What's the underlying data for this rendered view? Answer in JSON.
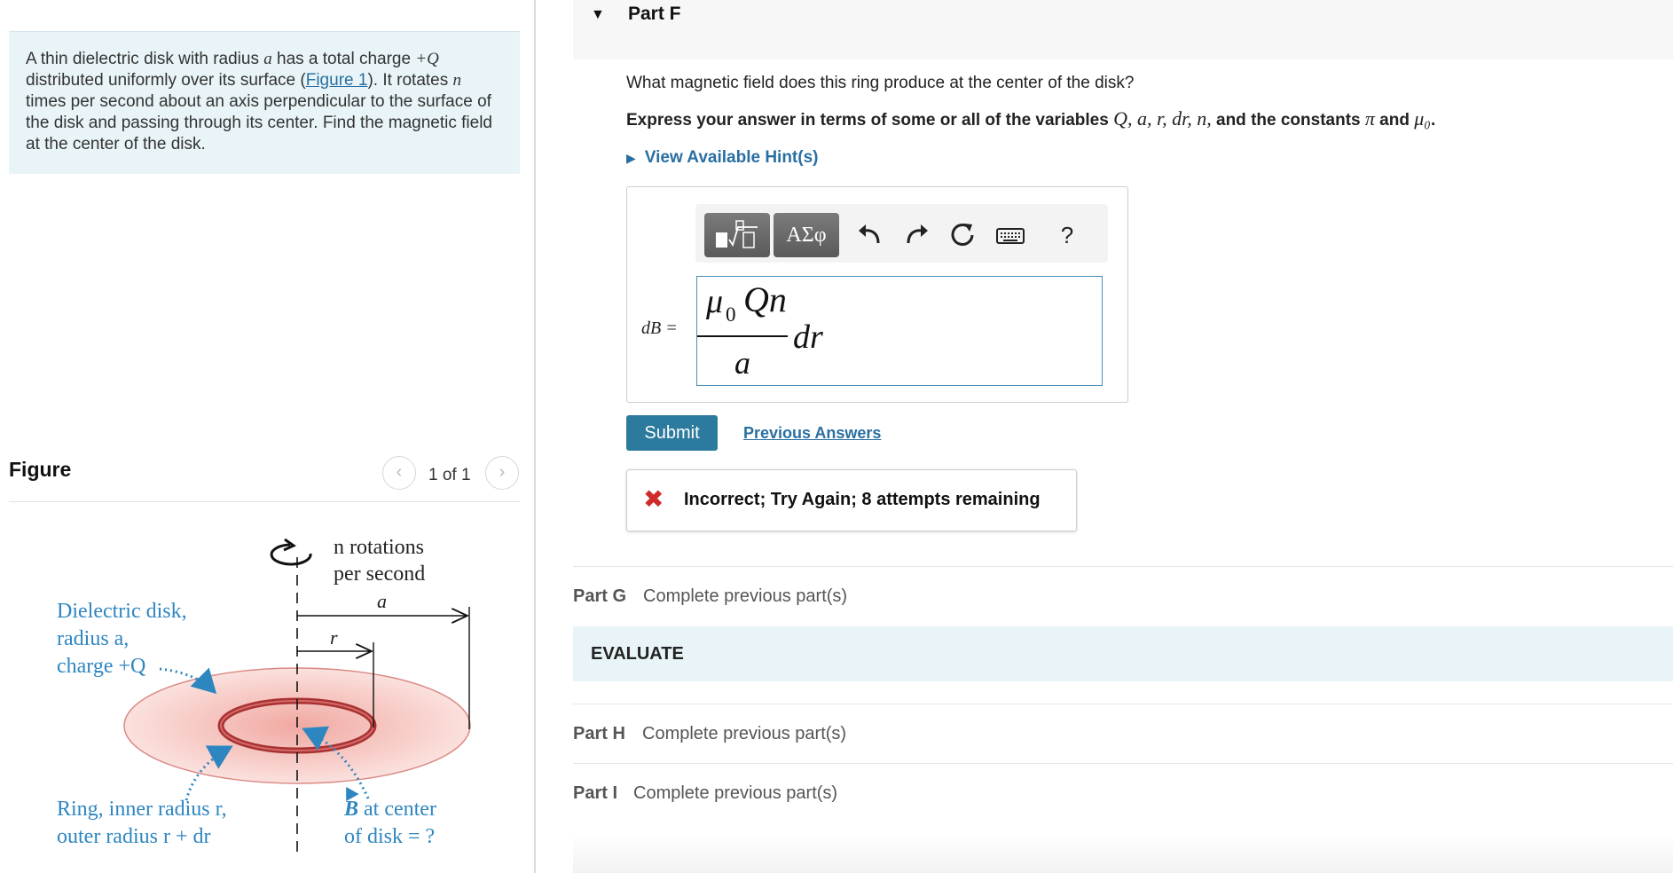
{
  "problem": {
    "text_1": "A thin dielectric disk with radius ",
    "var_a": "a",
    "text_2": " has a total charge ",
    "var_Q": "+Q",
    "text_3": " distributed uniformly over its surface (",
    "figure_link": "Figure 1",
    "text_4": "). It rotates ",
    "var_n": "n",
    "text_5": " times per second about an axis perpendicular to the surface of the disk and passing through its center. Find the magnetic field at the center of the disk."
  },
  "figure": {
    "title": "Figure",
    "pager": "1 of 1",
    "prev_icon": "chevron-left-icon",
    "next_icon": "chevron-right-icon",
    "labels": {
      "rotation_line1": "n rotations",
      "rotation_line2": "per second",
      "radius_a": "a",
      "radius_r": "r",
      "disk_line1": "Dielectric disk,",
      "disk_line2": "radius a,",
      "disk_line3": "charge +Q",
      "ring_line1": "Ring, inner radius r,",
      "ring_line2": "outer radius r + dr",
      "b_line1_symbol": "B",
      "b_line1_rest": " at center",
      "b_line2": "of disk = ?"
    },
    "colors": {
      "label_blue": "#2e86c1",
      "disk_fill": "#f6c9c4",
      "ring_stroke": "#a83232"
    }
  },
  "part_f": {
    "caret_icon": "caret-down-icon",
    "title": "Part F",
    "question": "What magnetic field does this ring produce at the center of the disk?",
    "instruction_1": "Express your answer in terms of some or all of the variables ",
    "instruction_vars": "Q, a, r, dr, n,",
    "instruction_2": " and the constants ",
    "instruction_consts": "π",
    "instruction_3": " and ",
    "instruction_mu": "μ₀",
    "instruction_end": ".",
    "hint_caret_icon": "caret-right-icon",
    "hint_link": "View Available Hint(s)",
    "toolbar": {
      "templates_icon": "templates-icon",
      "symbols_label": "ΑΣφ",
      "undo_icon": "undo-icon",
      "redo_icon": "redo-icon",
      "reset_icon": "reset-icon",
      "keyboard_icon": "keyboard-icon",
      "help_label": "?"
    },
    "answer_label": "dB =",
    "answer": {
      "numerator_mu": "μ",
      "numerator_sub": "0",
      "numerator_rest": "Qn",
      "denominator": "a",
      "multiplier": "dr"
    },
    "submit_label": "Submit",
    "previous_answers_label": "Previous Answers",
    "feedback_icon": "x-icon",
    "feedback_text": "Incorrect; Try Again; 8 attempts remaining"
  },
  "other_parts": {
    "part_g_label": "Part G",
    "part_g_status": "Complete previous part(s)",
    "evaluate_label": "EVALUATE",
    "part_h_label": "Part H",
    "part_h_status": "Complete previous part(s)",
    "part_i_label": "Part I",
    "part_i_status": "Complete previous part(s)"
  }
}
